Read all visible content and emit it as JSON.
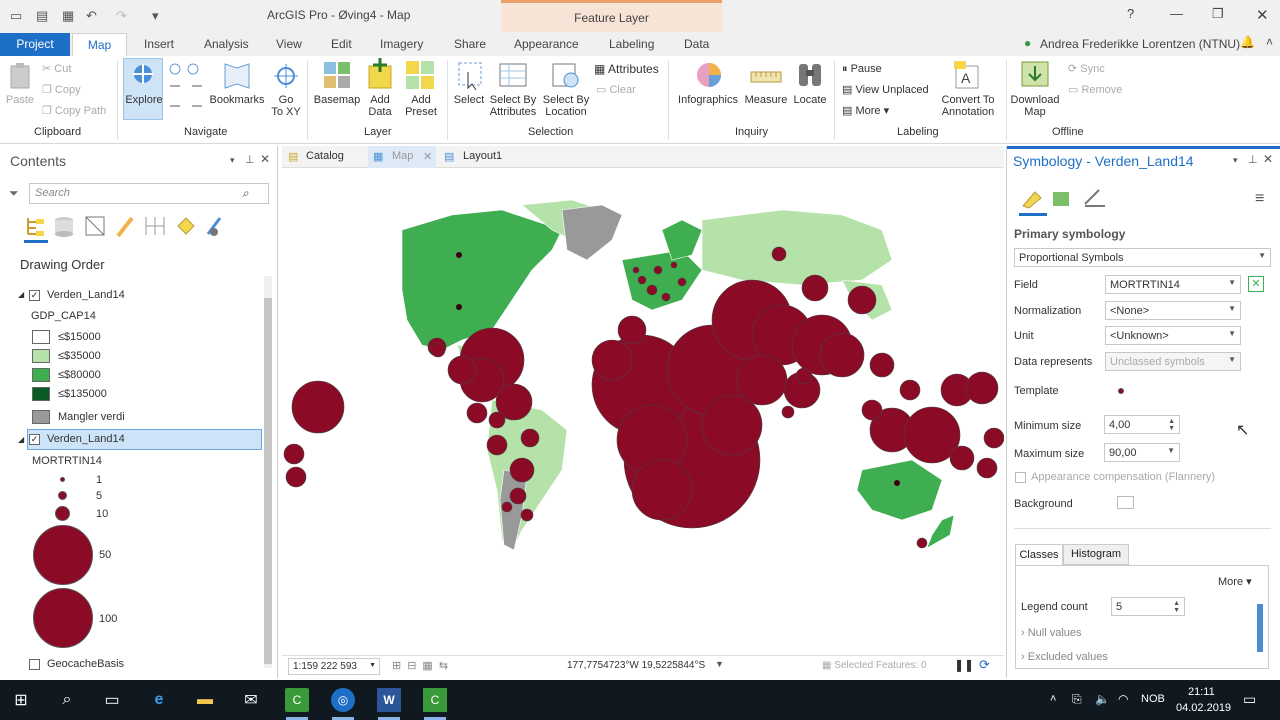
{
  "app": {
    "title": "ArcGIS Pro - Øving4 - Map",
    "context_tab": "Feature Layer",
    "user": "Andrea Frederikke Lorentzen (NTNU)",
    "help": "?"
  },
  "tabs": [
    "Project",
    "Map",
    "Insert",
    "Analysis",
    "View",
    "Edit",
    "Imagery",
    "Share",
    "Appearance",
    "Labeling",
    "Data"
  ],
  "ribbon": {
    "clipboard": {
      "paste": "Paste",
      "cut": "Cut",
      "copy": "Copy",
      "copy_path": "Copy Path",
      "group": "Clipboard"
    },
    "navigate": {
      "explore": "Explore",
      "bookmarks": "Bookmarks",
      "goto_xy": "Go\nTo XY",
      "group": "Navigate"
    },
    "layer": {
      "basemap": "Basemap",
      "add_data": "Add\nData",
      "add_preset": "Add\nPreset",
      "group": "Layer"
    },
    "selection": {
      "select": "Select",
      "select_by_attributes": "Select By\nAttributes",
      "select_by_location": "Select By\nLocation",
      "attributes": "Attributes",
      "clear": "Clear",
      "group": "Selection"
    },
    "inquiry": {
      "infographics": "Infographics",
      "measure": "Measure",
      "locate": "Locate",
      "group": "Inquiry"
    },
    "labeling": {
      "pause": "Pause",
      "view_unplaced": "View Unplaced",
      "more": "More",
      "convert": "Convert To\nAnnotation",
      "group": "Labeling"
    },
    "offline": {
      "download_map": "Download\nMap",
      "sync": "Sync",
      "remove": "Remove",
      "group": "Offline"
    }
  },
  "contents": {
    "title": "Contents",
    "search_placeholder": "Search",
    "drawing_order": "Drawing Order",
    "layer1": {
      "name": "Verden_Land14",
      "field": "GDP_CAP14",
      "classes": [
        {
          "label": "≤$15000",
          "color": "#ffffff"
        },
        {
          "label": "≤$35000",
          "color": "#b5e2a8"
        },
        {
          "label": "≤$80000",
          "color": "#3fae50"
        },
        {
          "label": "≤$135000",
          "color": "#0a5a25"
        },
        {
          "label": "Mangler verdi",
          "color": "#999999"
        }
      ]
    },
    "layer2": {
      "name": "Verden_Land14",
      "field": "MORTRTIN14",
      "sizes": [
        "1",
        "5",
        "10",
        "50",
        "100"
      ]
    },
    "layer3": {
      "name": "GeocacheBasis"
    }
  },
  "doc_tabs": [
    "Catalog",
    "Map",
    "Layout1"
  ],
  "status": {
    "scale": "1:159 222 593",
    "coords": "177,7754723°W 19,5225844°S",
    "selected": "Selected Features: 0"
  },
  "symbology": {
    "title": "Symbology - Verden_Land14",
    "primary": "Primary symbology",
    "method": "Proportional Symbols",
    "field_label": "Field",
    "field": "MORTRTIN14",
    "norm_label": "Normalization",
    "norm": "<None>",
    "unit_label": "Unit",
    "unit": "<Unknown>",
    "represents_label": "Data represents",
    "represents": "Unclassed symbols",
    "template_label": "Template",
    "min_label": "Minimum size",
    "min": "4,00",
    "max_label": "Maximum size",
    "max": "90,00",
    "flannery": "Appearance compensation (Flannery)",
    "background_label": "Background",
    "tab_classes": "Classes",
    "tab_histogram": "Histogram",
    "more": "More",
    "legend_label": "Legend count",
    "legend_count": "5",
    "null_values": "Null values",
    "excluded": "Excluded values"
  },
  "taskbar": {
    "lang": "NOB",
    "time": "21:11",
    "date": "04.02.2019"
  },
  "colors": {
    "accent": "#1e6fc7",
    "symbol": "#8b0a26",
    "gray": "#999999",
    "light_green": "#b5e2a8",
    "green": "#3fae50"
  }
}
